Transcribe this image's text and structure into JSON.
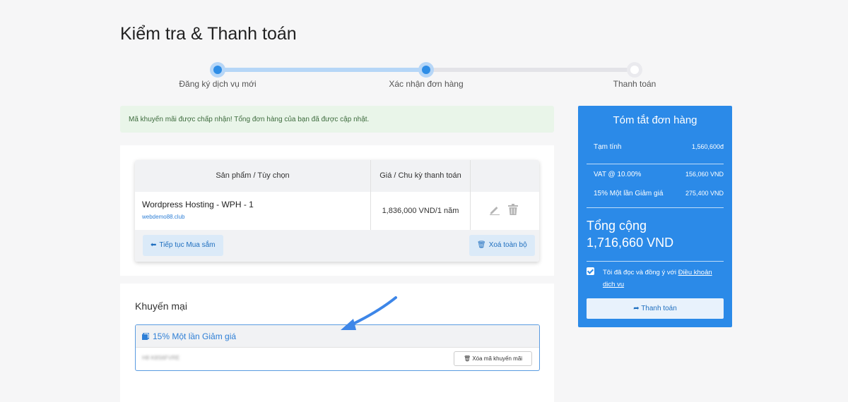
{
  "page": {
    "title": "Kiểm tra & Thanh toán"
  },
  "steps": [
    {
      "label": "Đăng ký dịch vụ mới",
      "state": "done"
    },
    {
      "label": "Xác nhận đơn hàng",
      "state": "current"
    },
    {
      "label": "Thanh toán",
      "state": "pending"
    }
  ],
  "alert": {
    "text": "Mã khuyến mãi được chấp nhận! Tổng đơn hàng của bạn đã được cập nhật."
  },
  "cart": {
    "headers": {
      "product": "Sản phẩm / Tùy chọn",
      "price": "Giá / Chu kỳ thanh toán"
    },
    "items": [
      {
        "name": "Wordpress Hosting - WPH - 1",
        "domain": "webdemo88.club",
        "price": "1,836,000 VND/1 năm"
      }
    ],
    "continue_label": "Tiếp tục Mua sắm",
    "clear_label": "Xoá toàn bộ"
  },
  "promo": {
    "title": "Khuyến mại",
    "applied_name": "15% Một lần Giảm giá",
    "code_blurred": "H8 K8S6FVRE",
    "remove_label": "Xóa mã khuyến mãi"
  },
  "summary": {
    "title": "Tóm tắt đơn hàng",
    "subtotal_label": "Tạm tính",
    "subtotal_value": "1,560,600đ",
    "vat_label": "VAT @ 10.00%",
    "vat_value": "156,060 VND",
    "discount_label": "15% Một lần Giảm giá",
    "discount_value": "275,400 VND",
    "total_label": "Tổng cộng",
    "total_value": "1,716,660 VND",
    "agree_text": "Tôi đã đọc và đồng ý với ",
    "terms_link": "Điều khoản dịch vụ",
    "terms_checked": true,
    "checkout_label": "Thanh toán"
  },
  "colors": {
    "accent": "#2b8ae8",
    "alert_bg": "#e9f5e9",
    "progress_fill": "#b6d6f7"
  }
}
